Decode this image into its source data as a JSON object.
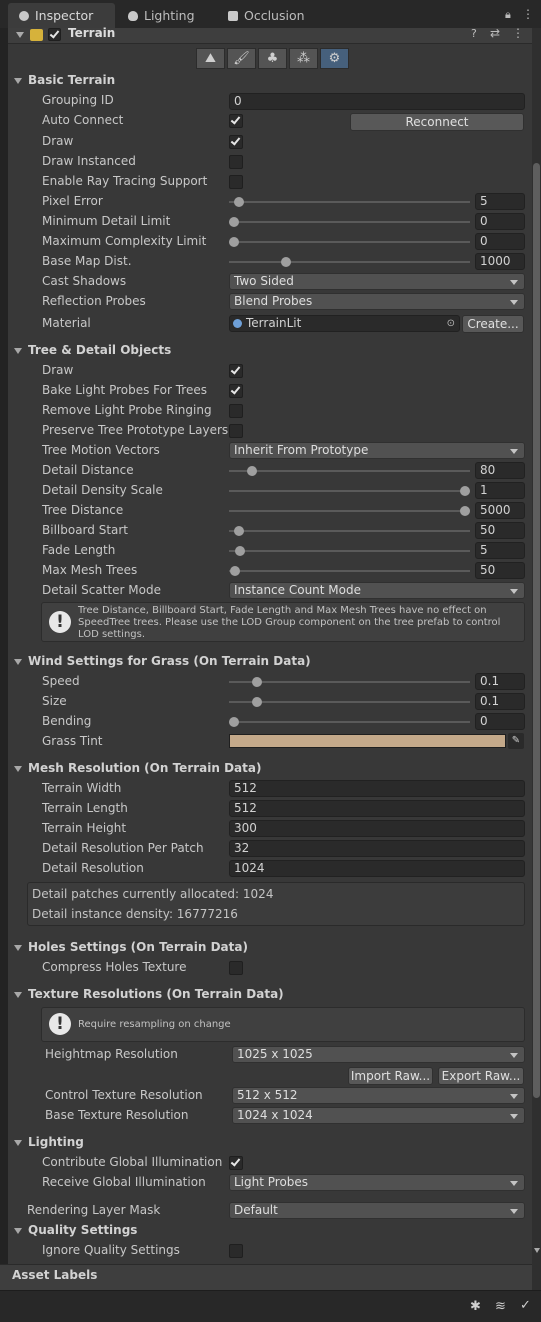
{
  "tabs": [
    {
      "label": "Inspector",
      "icon": "info-icon"
    },
    {
      "label": "Lighting",
      "icon": "lightbulb-icon"
    },
    {
      "label": "Occlusion",
      "icon": "occlusion-icon"
    }
  ],
  "component": {
    "title": "Terrain",
    "enabled": true
  },
  "toolbar_tools": [
    "raise-terrain-tool",
    "paint-terrain-tool",
    "paint-trees-tool",
    "paint-details-tool",
    "terrain-settings-tool"
  ],
  "basic_terrain": {
    "header": "Basic Terrain",
    "grouping_id": {
      "label": "Grouping ID",
      "value": "0"
    },
    "auto_connect": {
      "label": "Auto Connect",
      "checked": true,
      "button": "Reconnect"
    },
    "draw": {
      "label": "Draw",
      "checked": true
    },
    "draw_instanced": {
      "label": "Draw Instanced",
      "checked": false
    },
    "ray_tracing": {
      "label": "Enable Ray Tracing Support",
      "checked": false
    },
    "pixel_error": {
      "label": "Pixel Error",
      "value": "5"
    },
    "min_detail": {
      "label": "Minimum Detail Limit",
      "value": "0"
    },
    "max_complexity": {
      "label": "Maximum Complexity Limit",
      "value": "0"
    },
    "base_map_dist": {
      "label": "Base Map Dist.",
      "value": "1000"
    },
    "cast_shadows": {
      "label": "Cast Shadows",
      "value": "Two Sided"
    },
    "reflection_probes": {
      "label": "Reflection Probes",
      "value": "Blend Probes"
    },
    "material": {
      "label": "Material",
      "value": "TerrainLit",
      "button": "Create..."
    }
  },
  "tree_detail": {
    "header": "Tree & Detail Objects",
    "draw": {
      "label": "Draw",
      "checked": true
    },
    "bake_light_probes": {
      "label": "Bake Light Probes For Trees",
      "checked": true
    },
    "remove_ringing": {
      "label": "Remove Light Probe Ringing",
      "checked": false
    },
    "preserve_layers": {
      "label": "Preserve Tree Prototype Layers",
      "checked": false
    },
    "motion_vectors": {
      "label": "Tree Motion Vectors",
      "value": "Inherit From Prototype"
    },
    "detail_distance": {
      "label": "Detail Distance",
      "value": "80"
    },
    "detail_density": {
      "label": "Detail Density Scale",
      "value": "1"
    },
    "tree_distance": {
      "label": "Tree Distance",
      "value": "5000"
    },
    "billboard_start": {
      "label": "Billboard Start",
      "value": "50"
    },
    "fade_length": {
      "label": "Fade Length",
      "value": "5"
    },
    "max_mesh_trees": {
      "label": "Max Mesh Trees",
      "value": "50"
    },
    "scatter_mode": {
      "label": "Detail Scatter Mode",
      "value": "Instance Count Mode"
    },
    "help": "Tree Distance, Billboard Start, Fade Length and Max Mesh Trees have no effect on SpeedTree trees. Please use the LOD Group component on the tree prefab to control LOD settings."
  },
  "wind": {
    "header": "Wind Settings for Grass (On Terrain Data)",
    "speed": {
      "label": "Speed",
      "value": "0.1"
    },
    "size": {
      "label": "Size",
      "value": "0.1"
    },
    "bending": {
      "label": "Bending",
      "value": "0"
    },
    "grass_tint": {
      "label": "Grass Tint",
      "color": "#c4a98a"
    }
  },
  "mesh": {
    "header": "Mesh Resolution (On Terrain Data)",
    "width": {
      "label": "Terrain Width",
      "value": "512"
    },
    "length": {
      "label": "Terrain Length",
      "value": "512"
    },
    "height": {
      "label": "Terrain Height",
      "value": "300"
    },
    "per_patch": {
      "label": "Detail Resolution Per Patch",
      "value": "32"
    },
    "detail_res": {
      "label": "Detail Resolution",
      "value": "1024"
    },
    "info1": "Detail patches currently allocated: 1024",
    "info2": "Detail instance density: 16777216"
  },
  "holes": {
    "header": "Holes Settings (On Terrain Data)",
    "compress": {
      "label": "Compress Holes Texture",
      "checked": false
    }
  },
  "texture": {
    "header": "Texture Resolutions (On Terrain Data)",
    "help": "Require resampling on change",
    "heightmap": {
      "label": "Heightmap Resolution",
      "value": "1025 x 1025"
    },
    "import_btn": "Import Raw...",
    "export_btn": "Export Raw...",
    "control": {
      "label": "Control Texture Resolution",
      "value": "512 x 512"
    },
    "base": {
      "label": "Base Texture Resolution",
      "value": "1024 x 1024"
    }
  },
  "lighting": {
    "header": "Lighting",
    "contribute_gi": {
      "label": "Contribute Global Illumination",
      "checked": true
    },
    "receive_gi": {
      "label": "Receive Global Illumination",
      "value": "Light Probes"
    }
  },
  "rendering_layer": {
    "label": "Rendering Layer Mask",
    "value": "Default"
  },
  "quality": {
    "header": "Quality Settings",
    "ignore": {
      "label": "Ignore Quality Settings",
      "checked": false
    }
  },
  "asset_labels": "Asset Labels"
}
